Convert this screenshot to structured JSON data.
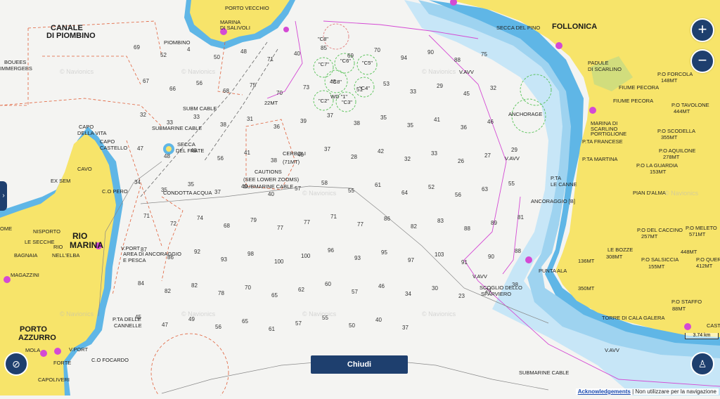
{
  "ui": {
    "zoom_in": "+",
    "zoom_out": "−",
    "close_label": "Chiudi",
    "acknowledgements": "Acknowledgements",
    "disclaimer": "Non utilizzare per la navigazione",
    "scale_label": "3.74 km",
    "watermark": "© Navionics"
  },
  "places": {
    "canale": "CANALE",
    "di_piombino": "DI PIOMBINO",
    "follonica": "FOLLONICA",
    "rio_marina_1": "RIO",
    "rio_marina_2": "MARINA",
    "porto_azzurro_1": "PORTO",
    "porto_azzurro_2": "AZZURRO"
  },
  "labels": {
    "porto_vecchio": "PORTO VECCHIO",
    "marina_salivoli_1": "MARINA",
    "marina_salivoli_2": "DI SALIVOLI",
    "piombino": "PIOMBINO",
    "secca_del_pino": "SECCA DEL PINO",
    "padule_1": "PADULE",
    "padule_2": "DI SCARLINO",
    "fiume_pecora_1": "FIUME PECORA",
    "fiume_pecora_2": "FIUME PECORA",
    "marina_scarlino_1": "MARINA DI",
    "marina_scarlino_2": "SCARLINO",
    "marina_scarlino_3": "PORTIGLIONE",
    "pta_francese": "P.TA FRANCESE",
    "pta_martina": "P.TA MARTINA",
    "pta_le_canne_1": "P.TA",
    "pta_le_canne_2": "LE CANNE",
    "anchorage": "ANCHORAGE",
    "ancoraggio": "ANCORAGGIO [B]",
    "pian_dalma": "PIAN D'ALMA",
    "po_forcola": "P.O FORCOLA",
    "po_forcola_h": "148MT",
    "po_tavolone": "P.O TAVOLONE",
    "po_tavolone_h": "444MT",
    "po_scodella": "P.O SCODELLA",
    "po_scodella_h": "355MT",
    "po_aquilone": "P.O AQUILONE",
    "po_aquilone_h": "278MT",
    "po_guardia": "P.O LA GUARDIA",
    "po_guardia_h": "153MT",
    "po_caccino": "P.O DEL CACCINO",
    "po_caccino_h": "257MT",
    "po_meleto": "P.O MELETO",
    "po_meleto_h": "571MT",
    "le_bozze": "LE BOZZE",
    "le_bozze_h": "308MT",
    "h136": "136MT",
    "po_salsicia": "P.O SALSICCIA",
    "po_salsicia_h": "155MT",
    "po_querc": "P.O QUERC",
    "po_querc_h": "412MT",
    "h448": "448MT",
    "punta_ala": "PUNTA ALA",
    "h350": "350MT",
    "po_staffo": "P.O STAFFO",
    "po_staffo_h": "88MT",
    "torre_cala_galera": "TORRE DI CALA GALERA",
    "cast": "CAST",
    "scoglio_1": "SCOGLIO DELLO",
    "scoglio_2": "SPARVIERO",
    "submarine_cable_1": "SUBMARINE CABLE",
    "submarine_cable_2": "SUBMARINE CABLE",
    "submarine_cable_3": "SUBMARINE CABLE",
    "sub_cable_short": "SUBM CABLE",
    "cerboli_1": "CERBOLI",
    "cerboli_2": "(71MT)",
    "caution_1": "CAUTIONS",
    "caution_2": "(SEE LOWER ZOOMS)",
    "condotta": "CONDOTTA ACQUA",
    "secca_frate_1": "SECCA",
    "secca_frate_2": "DEL FRATE",
    "mt22": "22MT",
    "boues_1": "BOUEES",
    "boues_2": "IMMERGEES",
    "capo_vita_1": "CAPO",
    "capo_vita_2": "DELLA VITA",
    "capo_castello_1": "CAPO",
    "capo_castello_2": "CASTELLO",
    "cavo": "CAVO",
    "ex_sem": "EX SEM",
    "co_pero": "C.O PERO",
    "nisporto": "NISPORTO",
    "le_secche": "LE SECCHE",
    "rio_elba_1": "RIO",
    "rio_elba_2": "NELL'ELBA",
    "bagnaia": "BAGNAIA",
    "ome": "OME",
    "magazzini": "MAGAZZINI",
    "vport": "V.PORT",
    "area_ancoraggio_1": "AREA DI ANCORAGGIO",
    "area_ancoraggio_2": "E PESCA",
    "pta_cannelle_1": "P.TA DELLE",
    "pta_cannelle_2": "CANNELLE",
    "mola": "MOLA",
    "vport2": "V.PORT",
    "porto_azzurro_co": "C.O FOCARDO",
    "forte": "FORTE",
    "capoliveri": "CAPOLIVERI",
    "vavv_1": "V.AVV",
    "vavv_2": "V.AVV",
    "vavv_3": "V.AVV",
    "vavv_4": "V.AVV",
    "c8a": "\"C8\"",
    "c7": "\"C7\"",
    "c6": "\"C6\"",
    "c5": "\"C5\"",
    "c3": "\"C3\"",
    "c2": "\"C2\"",
    "c4": "\"C4\"",
    "c8b": "\"C8\"",
    "wd": "WD \"1\""
  },
  "soundings": [
    "69",
    "52",
    "4",
    "50",
    "48",
    "71",
    "40",
    "85",
    "69",
    "70",
    "94",
    "90",
    "88",
    "75",
    "67",
    "66",
    "56",
    "68",
    "75",
    "70",
    "73",
    "43",
    "51",
    "53",
    "33",
    "29",
    "45",
    "32",
    "32",
    "33",
    "33",
    "38",
    "31",
    "36",
    "39",
    "37",
    "38",
    "35",
    "35",
    "41",
    "36",
    "46",
    "47",
    "48",
    "48",
    "56",
    "41",
    "38",
    "40",
    "37",
    "28",
    "42",
    "32",
    "33",
    "26",
    "27",
    "29",
    "34",
    "35",
    "35",
    "37",
    "40",
    "40",
    "57",
    "58",
    "55",
    "61",
    "64",
    "52",
    "56",
    "63",
    "55",
    "71",
    "72",
    "74",
    "68",
    "79",
    "77",
    "77",
    "71",
    "77",
    "86",
    "82",
    "83",
    "88",
    "89",
    "81",
    "87",
    "86",
    "92",
    "93",
    "98",
    "100",
    "100",
    "96",
    "93",
    "95",
    "97",
    "103",
    "91",
    "90",
    "88",
    "84",
    "82",
    "82",
    "78",
    "70",
    "65",
    "62",
    "60",
    "57",
    "46",
    "34",
    "30",
    "23",
    "24",
    "38",
    "45",
    "47",
    "49",
    "56",
    "65",
    "61",
    "57",
    "55",
    "50",
    "40",
    "37"
  ]
}
